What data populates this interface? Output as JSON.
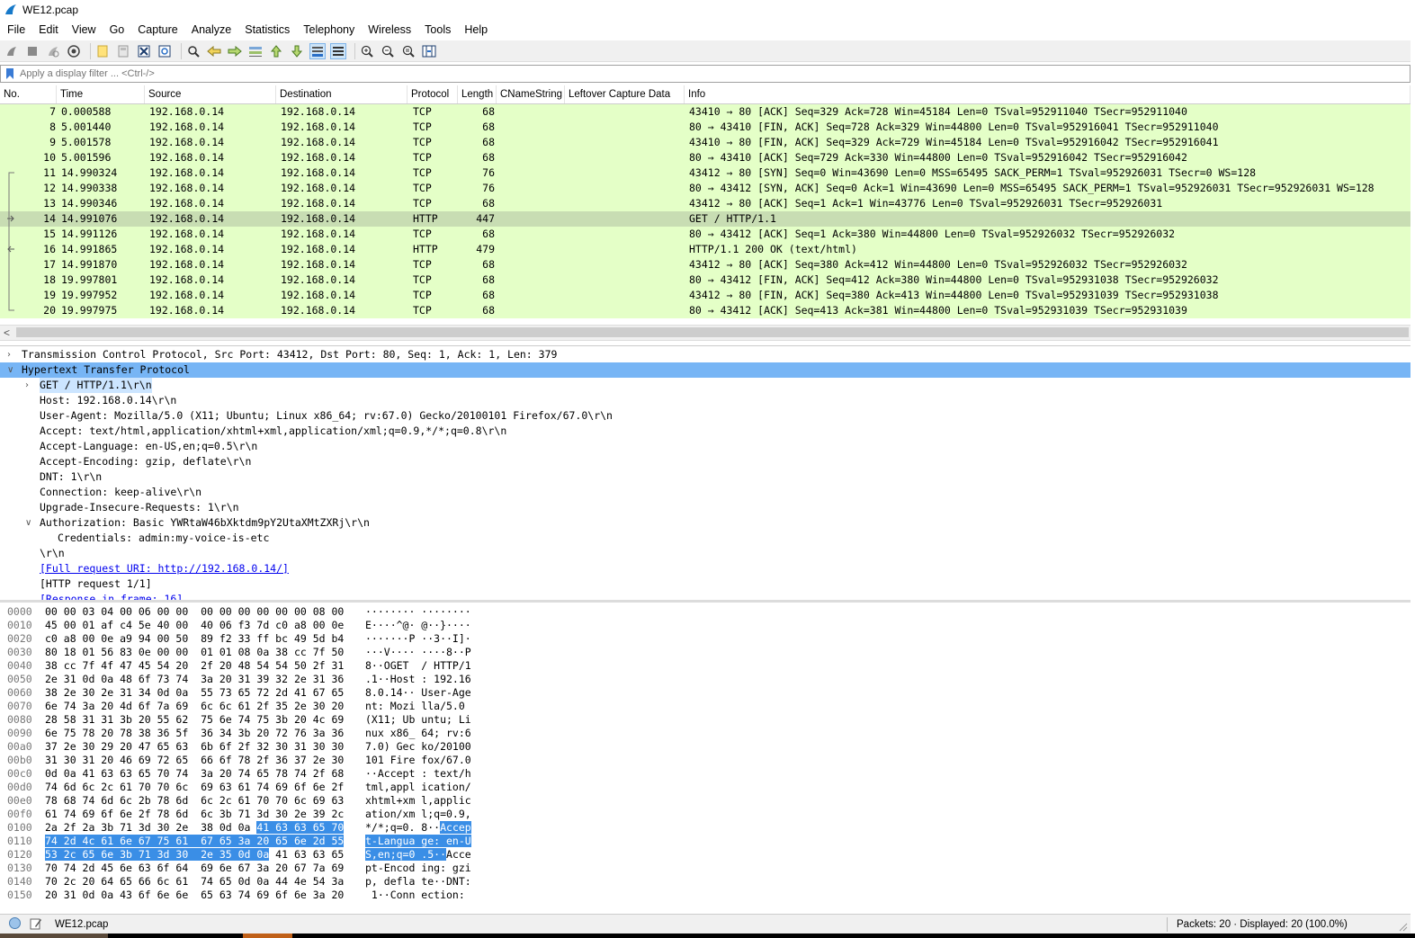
{
  "window": {
    "title": "WE12.pcap"
  },
  "menu": [
    "File",
    "Edit",
    "View",
    "Go",
    "Capture",
    "Analyze",
    "Statistics",
    "Telephony",
    "Wireless",
    "Tools",
    "Help"
  ],
  "toolbar": {
    "icons": [
      "start-capture-icon",
      "stop-capture-icon",
      "restart-capture-icon",
      "capture-options-icon",
      "open-file-icon",
      "save-file-icon",
      "close-file-icon",
      "reload-file-icon",
      "find-packet-icon",
      "go-back-icon",
      "go-forward-icon",
      "go-to-packet-icon",
      "go-first-packet-icon",
      "go-last-packet-icon",
      "auto-scroll-icon",
      "colorize-icon",
      "zoom-in-icon",
      "zoom-out-icon",
      "zoom-normal-icon",
      "resize-columns-icon"
    ],
    "accent": "#7eb4ea"
  },
  "filter": {
    "placeholder": "Apply a display filter ... <Ctrl-/>"
  },
  "packet_list": {
    "columns": [
      "No.",
      "Time",
      "Source",
      "Destination",
      "Protocol",
      "Length",
      "CNameString",
      "Leftover Capture Data",
      "Info"
    ],
    "row_color": "#e4ffc7",
    "selected_row_color": "#c8ddb3",
    "rows": [
      {
        "no": "7",
        "time": "0.000588",
        "src": "192.168.0.14",
        "dst": "192.168.0.14",
        "proto": "TCP",
        "len": "68",
        "info": "43410 → 80 [ACK] Seq=329 Ack=728 Win=45184 Len=0 TSval=952911040 TSecr=952911040"
      },
      {
        "no": "8",
        "time": "5.001440",
        "src": "192.168.0.14",
        "dst": "192.168.0.14",
        "proto": "TCP",
        "len": "68",
        "info": "80 → 43410 [FIN, ACK] Seq=728 Ack=329 Win=44800 Len=0 TSval=952916041 TSecr=952911040"
      },
      {
        "no": "9",
        "time": "5.001578",
        "src": "192.168.0.14",
        "dst": "192.168.0.14",
        "proto": "TCP",
        "len": "68",
        "info": "43410 → 80 [FIN, ACK] Seq=329 Ack=729 Win=45184 Len=0 TSval=952916042 TSecr=952916041"
      },
      {
        "no": "10",
        "time": "5.001596",
        "src": "192.168.0.14",
        "dst": "192.168.0.14",
        "proto": "TCP",
        "len": "68",
        "info": "80 → 43410 [ACK] Seq=729 Ack=330 Win=44800 Len=0 TSval=952916042 TSecr=952916042"
      },
      {
        "no": "11",
        "time": "14.990324",
        "src": "192.168.0.14",
        "dst": "192.168.0.14",
        "proto": "TCP",
        "len": "76",
        "info": "43412 → 80 [SYN] Seq=0 Win=43690 Len=0 MSS=65495 SACK_PERM=1 TSval=952926031 TSecr=0 WS=128"
      },
      {
        "no": "12",
        "time": "14.990338",
        "src": "192.168.0.14",
        "dst": "192.168.0.14",
        "proto": "TCP",
        "len": "76",
        "info": "80 → 43412 [SYN, ACK] Seq=0 Ack=1 Win=43690 Len=0 MSS=65495 SACK_PERM=1 TSval=952926031 TSecr=952926031 WS=128"
      },
      {
        "no": "13",
        "time": "14.990346",
        "src": "192.168.0.14",
        "dst": "192.168.0.14",
        "proto": "TCP",
        "len": "68",
        "info": "43412 → 80 [ACK] Seq=1 Ack=1 Win=43776 Len=0 TSval=952926031 TSecr=952926031"
      },
      {
        "no": "14",
        "time": "14.991076",
        "src": "192.168.0.14",
        "dst": "192.168.0.14",
        "proto": "HTTP",
        "len": "447",
        "info": "GET / HTTP/1.1",
        "selected": true
      },
      {
        "no": "15",
        "time": "14.991126",
        "src": "192.168.0.14",
        "dst": "192.168.0.14",
        "proto": "TCP",
        "len": "68",
        "info": "80 → 43412 [ACK] Seq=1 Ack=380 Win=44800 Len=0 TSval=952926032 TSecr=952926032"
      },
      {
        "no": "16",
        "time": "14.991865",
        "src": "192.168.0.14",
        "dst": "192.168.0.14",
        "proto": "HTTP",
        "len": "479",
        "info": "HTTP/1.1 200 OK  (text/html)"
      },
      {
        "no": "17",
        "time": "14.991870",
        "src": "192.168.0.14",
        "dst": "192.168.0.14",
        "proto": "TCP",
        "len": "68",
        "info": "43412 → 80 [ACK] Seq=380 Ack=412 Win=44800 Len=0 TSval=952926032 TSecr=952926032"
      },
      {
        "no": "18",
        "time": "19.997801",
        "src": "192.168.0.14",
        "dst": "192.168.0.14",
        "proto": "TCP",
        "len": "68",
        "info": "80 → 43412 [FIN, ACK] Seq=412 Ack=380 Win=44800 Len=0 TSval=952931038 TSecr=952926032"
      },
      {
        "no": "19",
        "time": "19.997952",
        "src": "192.168.0.14",
        "dst": "192.168.0.14",
        "proto": "TCP",
        "len": "68",
        "info": "43412 → 80 [FIN, ACK] Seq=380 Ack=413 Win=44800 Len=0 TSval=952931039 TSecr=952931038"
      },
      {
        "no": "20",
        "time": "19.997975",
        "src": "192.168.0.14",
        "dst": "192.168.0.14",
        "proto": "TCP",
        "len": "68",
        "info": "80 → 43412 [ACK] Seq=413 Ack=381 Win=44800 Len=0 TSval=952931039 TSecr=952931039"
      }
    ]
  },
  "details": {
    "highlight_color": "#77b5f5",
    "lines": [
      {
        "arrow": "collapsed",
        "indent": 0,
        "text": "Transmission Control Protocol, Src Port: 43412, Dst Port: 80, Seq: 1, Ack: 1, Len: 379"
      },
      {
        "arrow": "expanded",
        "indent": 0,
        "text": "Hypertext Transfer Protocol",
        "highlight": true
      },
      {
        "arrow": "collapsed",
        "indent": 1,
        "text": "GET / HTTP/1.1\\r\\n",
        "selected": true
      },
      {
        "indent": 1,
        "text": "Host: 192.168.0.14\\r\\n"
      },
      {
        "indent": 1,
        "text": "User-Agent: Mozilla/5.0 (X11; Ubuntu; Linux x86_64; rv:67.0) Gecko/20100101 Firefox/67.0\\r\\n"
      },
      {
        "indent": 1,
        "text": "Accept: text/html,application/xhtml+xml,application/xml;q=0.9,*/*;q=0.8\\r\\n"
      },
      {
        "indent": 1,
        "text": "Accept-Language: en-US,en;q=0.5\\r\\n"
      },
      {
        "indent": 1,
        "text": "Accept-Encoding: gzip, deflate\\r\\n"
      },
      {
        "indent": 1,
        "text": "DNT: 1\\r\\n"
      },
      {
        "indent": 1,
        "text": "Connection: keep-alive\\r\\n"
      },
      {
        "indent": 1,
        "text": "Upgrade-Insecure-Requests: 1\\r\\n"
      },
      {
        "arrow": "expanded",
        "indent": 1,
        "text": "Authorization: Basic YWRtaW46bXktdm9pY2UtaXMtZXRj\\r\\n"
      },
      {
        "indent": 2,
        "text": "Credentials: admin:my-voice-is-etc"
      },
      {
        "indent": 1,
        "text": "\\r\\n"
      },
      {
        "indent": 1,
        "text": "[Full request URI: http://192.168.0.14/]",
        "link": true
      },
      {
        "indent": 1,
        "text": "[HTTP request 1/1]"
      },
      {
        "indent": 1,
        "text": "[Response in frame: 16]",
        "link": true
      }
    ]
  },
  "bytes": {
    "highlight_color": "#3a8ee6",
    "rows": [
      {
        "off": "0000",
        "hex": "00 00 03 04 00 06 00 00  00 00 00 00 00 00 08 00",
        "ascii": "········ ········"
      },
      {
        "off": "0010",
        "hex": "45 00 01 af c4 5e 40 00  40 06 f3 7d c0 a8 00 0e",
        "ascii": "E····^@· @··}····"
      },
      {
        "off": "0020",
        "hex": "c0 a8 00 0e a9 94 00 50  89 f2 33 ff bc 49 5d b4",
        "ascii": "·······P ··3··I]·"
      },
      {
        "off": "0030",
        "hex": "80 18 01 56 83 0e 00 00  01 01 08 0a 38 cc 7f 50",
        "ascii": "···V···· ····8··P"
      },
      {
        "off": "0040",
        "hex": "38 cc 7f 4f 47 45 54 20  2f 20 48 54 54 50 2f 31",
        "ascii": "8··OGET  / HTTP/1"
      },
      {
        "off": "0050",
        "hex": "2e 31 0d 0a 48 6f 73 74  3a 20 31 39 32 2e 31 36",
        "ascii": ".1··Host : 192.16"
      },
      {
        "off": "0060",
        "hex": "38 2e 30 2e 31 34 0d 0a  55 73 65 72 2d 41 67 65",
        "ascii": "8.0.14·· User-Age"
      },
      {
        "off": "0070",
        "hex": "6e 74 3a 20 4d 6f 7a 69  6c 6c 61 2f 35 2e 30 20",
        "ascii": "nt: Mozi lla/5.0 "
      },
      {
        "off": "0080",
        "hex": "28 58 31 31 3b 20 55 62  75 6e 74 75 3b 20 4c 69",
        "ascii": "(X11; Ub untu; Li"
      },
      {
        "off": "0090",
        "hex": "6e 75 78 20 78 38 36 5f  36 34 3b 20 72 76 3a 36",
        "ascii": "nux x86_ 64; rv:6"
      },
      {
        "off": "00a0",
        "hex": "37 2e 30 29 20 47 65 63  6b 6f 2f 32 30 31 30 30",
        "ascii": "7.0) Gec ko/20100"
      },
      {
        "off": "00b0",
        "hex": "31 30 31 20 46 69 72 65  66 6f 78 2f 36 37 2e 30",
        "ascii": "101 Fire fox/67.0"
      },
      {
        "off": "00c0",
        "hex": "0d 0a 41 63 63 65 70 74  3a 20 74 65 78 74 2f 68",
        "ascii": "··Accept : text/h"
      },
      {
        "off": "00d0",
        "hex": "74 6d 6c 2c 61 70 70 6c  69 63 61 74 69 6f 6e 2f",
        "ascii": "tml,appl ication/"
      },
      {
        "off": "00e0",
        "hex": "78 68 74 6d 6c 2b 78 6d  6c 2c 61 70 70 6c 69 63",
        "ascii": "xhtml+xm l,applic"
      },
      {
        "off": "00f0",
        "hex": "61 74 69 6f 6e 2f 78 6d  6c 3b 71 3d 30 2e 39 2c",
        "ascii": "ation/xm l;q=0.9,"
      },
      {
        "off": "0100",
        "hex_plain": "2a 2f 2a 3b 71 3d 30 2e  38 0d 0a ",
        "hex_hl": "41 63 63 65 70",
        "ascii_plain": "*/*;q=0. 8··",
        "ascii_hl": "Accep"
      },
      {
        "off": "0110",
        "hex_plain": "",
        "hex_hl": "74 2d 4c 61 6e 67 75 61  67 65 3a 20 65 6e 2d 55",
        "ascii_plain": "",
        "ascii_hl": "t-Langua ge: en-U"
      },
      {
        "off": "0120",
        "hex_hl": "53 2c 65 6e 3b 71 3d 30  2e 35 0d 0a",
        "hex_plain": " 41 63 63 65",
        "ascii_hl": "S,en;q=0 .5··",
        "ascii_plain": "Acce"
      },
      {
        "off": "0130",
        "hex": "70 74 2d 45 6e 63 6f 64  69 6e 67 3a 20 67 7a 69",
        "ascii": "pt-Encod ing: gzi"
      },
      {
        "off": "0140",
        "hex": "70 2c 20 64 65 66 6c 61  74 65 0d 0a 44 4e 54 3a",
        "ascii": "p, defla te··DNT:"
      },
      {
        "off": "0150",
        "hex": "20 31 0d 0a 43 6f 6e 6e  65 63 74 69 6f 6e 3a 20",
        "ascii": " 1··Conn ection: "
      }
    ]
  },
  "status": {
    "file": "WE12.pcap",
    "packets": "Packets: 20 · Displayed: 20 (100.0%)"
  }
}
